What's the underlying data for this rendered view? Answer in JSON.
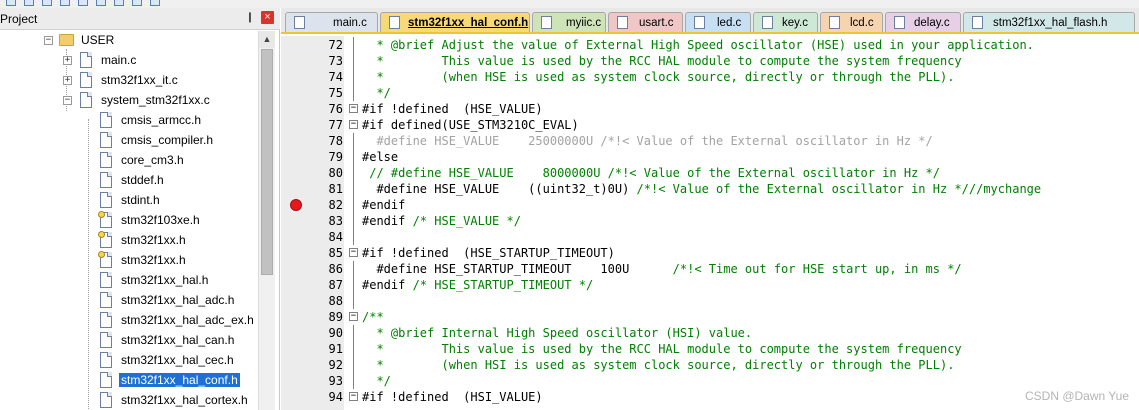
{
  "project_panel": {
    "title": "Project",
    "pin_glyph": "❙",
    "close_glyph": "×"
  },
  "tree": {
    "folder": "USER",
    "items": [
      {
        "label": "main.c",
        "kind": "c-file",
        "expandable": true
      },
      {
        "label": "stm32f1xx_it.c",
        "kind": "c-file",
        "expandable": true
      },
      {
        "label": "system_stm32f1xx.c",
        "kind": "c-file",
        "expandable": true,
        "expanded": true
      },
      {
        "label": "cmsis_armcc.h",
        "kind": "header"
      },
      {
        "label": "cmsis_compiler.h",
        "kind": "header"
      },
      {
        "label": "core_cm3.h",
        "kind": "header"
      },
      {
        "label": "stddef.h",
        "kind": "header"
      },
      {
        "label": "stdint.h",
        "kind": "header"
      },
      {
        "label": "stm32f103xe.h",
        "kind": "header-key"
      },
      {
        "label": "stm32f1xx.h",
        "kind": "header-key"
      },
      {
        "label": "stm32f1xx.h",
        "kind": "header-key"
      },
      {
        "label": "stm32f1xx_hal.h",
        "kind": "header"
      },
      {
        "label": "stm32f1xx_hal_adc.h",
        "kind": "header"
      },
      {
        "label": "stm32f1xx_hal_adc_ex.h",
        "kind": "header"
      },
      {
        "label": "stm32f1xx_hal_can.h",
        "kind": "header"
      },
      {
        "label": "stm32f1xx_hal_cec.h",
        "kind": "header"
      },
      {
        "label": "stm32f1xx_hal_conf.h",
        "kind": "header",
        "selected": true
      },
      {
        "label": "stm32f1xx_hal_cortex.h",
        "kind": "header"
      }
    ]
  },
  "tabs": [
    {
      "label": "main.c",
      "color": "#dde3ec"
    },
    {
      "label": "stm32f1xx_hal_conf.h",
      "color": "#f7d978",
      "active": true
    },
    {
      "label": "myiic.c",
      "color": "#cfe3b8"
    },
    {
      "label": "usart.c",
      "color": "#f1c6c6"
    },
    {
      "label": "led.c",
      "color": "#c6dff3"
    },
    {
      "label": "key.c",
      "color": "#cde9d6"
    },
    {
      "label": "lcd.c",
      "color": "#f6d4b0"
    },
    {
      "label": "delay.c",
      "color": "#e7cfe6"
    },
    {
      "label": "stm32f1xx_hal_flash.h",
      "color": "#d2e8e8"
    }
  ],
  "editor": {
    "lines": [
      {
        "n": "72",
        "t": "  * @brief Adjust the value of External High Speed oscillator (HSE) used in your application.",
        "style": "com"
      },
      {
        "n": "73",
        "t": "  *        This value is used by the RCC HAL module to compute the system frequency",
        "style": "com"
      },
      {
        "n": "74",
        "t": "  *        (when HSE is used as system clock source, directly or through the PLL).",
        "style": "com"
      },
      {
        "n": "75",
        "t": "  */",
        "style": "com"
      },
      {
        "n": "76",
        "t": "#if !defined  (HSE_VALUE)",
        "style": "pp",
        "fold": true
      },
      {
        "n": "77",
        "t": "#if defined(USE_STM3210C_EVAL)",
        "style": "pp",
        "fold": true
      },
      {
        "n": "78",
        "t": "  #define HSE_VALUE    25000000U /*!< Value of the External oscillator in Hz */",
        "style": "dis"
      },
      {
        "n": "79",
        "t": "#else",
        "style": "pp"
      },
      {
        "n": "80",
        "t": " // #define HSE_VALUE    8000000U /*!< Value of the External oscillator in Hz */",
        "style": "com"
      },
      {
        "n": "81",
        "t": "  #define HSE_VALUE    ((uint32_t)0U) /*!< Value of the External oscillator in Hz *///mychange",
        "style": "mix81"
      },
      {
        "n": "82",
        "t": "#endif",
        "style": "pp",
        "breakpoint": true
      },
      {
        "n": "83",
        "t": "#endif /* HSE_VALUE */",
        "style": "mixend"
      },
      {
        "n": "84",
        "t": "",
        "style": "pp"
      },
      {
        "n": "85",
        "t": "#if !defined  (HSE_STARTUP_TIMEOUT)",
        "style": "pp",
        "fold": true
      },
      {
        "n": "86",
        "t": "  #define HSE_STARTUP_TIMEOUT    100U      /*!< Time out for HSE start up, in ms */",
        "style": "mix86"
      },
      {
        "n": "87",
        "t": "#endif /* HSE_STARTUP_TIMEOUT */",
        "style": "mixend"
      },
      {
        "n": "88",
        "t": "",
        "style": "pp"
      },
      {
        "n": "89",
        "t": "/**",
        "style": "com",
        "fold": true
      },
      {
        "n": "90",
        "t": "  * @brief Internal High Speed oscillator (HSI) value.",
        "style": "com"
      },
      {
        "n": "91",
        "t": "  *        This value is used by the RCC HAL module to compute the system frequency",
        "style": "com"
      },
      {
        "n": "92",
        "t": "  *        (when HSI is used as system clock source, directly or through the PLL).",
        "style": "com"
      },
      {
        "n": "93",
        "t": "  */",
        "style": "com"
      },
      {
        "n": "94",
        "t": "#if !defined  (HSI_VALUE)",
        "style": "pp",
        "fold": true
      }
    ]
  },
  "watermark": "CSDN @Dawn Yue"
}
